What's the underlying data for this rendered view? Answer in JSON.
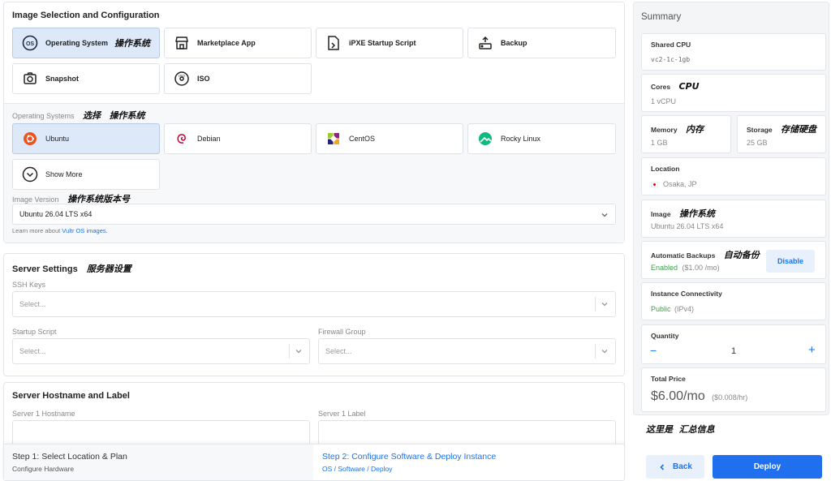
{
  "image_section": {
    "title": "Image Selection and Configuration",
    "tabs": [
      {
        "label": "Operating System",
        "annotation": "操作系统",
        "icon": "os-icon",
        "selected": true
      },
      {
        "label": "Marketplace App",
        "icon": "store-icon"
      },
      {
        "label": "iPXE Startup Script",
        "icon": "script-file-icon"
      },
      {
        "label": "Backup",
        "icon": "backup-icon"
      },
      {
        "label": "Snapshot",
        "icon": "snapshot-icon"
      },
      {
        "label": "ISO",
        "icon": "iso-disc-icon"
      }
    ]
  },
  "os_section": {
    "label": "Operating Systems",
    "annotation_1": "选择",
    "annotation_2": "操作系统",
    "options": [
      {
        "label": "Ubuntu",
        "icon": "ubuntu-icon",
        "selected": true
      },
      {
        "label": "Debian",
        "icon": "debian-icon"
      },
      {
        "label": "CentOS",
        "icon": "centos-icon"
      },
      {
        "label": "Rocky Linux",
        "icon": "rocky-linux-icon"
      },
      {
        "label": "Show More",
        "icon": "chevron-down-circle-icon"
      }
    ],
    "version_label": "Image Version",
    "version_annotation": "操作系统版本号",
    "version_value": "Ubuntu 26.04 LTS x64",
    "learn_prefix": "Learn more about ",
    "learn_link": "Vultr OS images."
  },
  "server_settings": {
    "title": "Server Settings",
    "annotation": "服务器设置",
    "ssh_label": "SSH Keys",
    "ssh_placeholder": "Select...",
    "startup_label": "Startup Script",
    "startup_placeholder": "Select...",
    "firewall_label": "Firewall Group",
    "firewall_placeholder": "Select..."
  },
  "hostname_section": {
    "title": "Server Hostname and Label",
    "hostname_label": "Server 1 Hostname",
    "label_label": "Server 1 Label"
  },
  "steps": {
    "step1_title": "Step 1: Select Location & Plan",
    "step1_sub": "Configure Hardware",
    "step2_title": "Step 2: Configure Software & Deploy Instance",
    "step2_sub": "OS / Software / Deploy"
  },
  "summary": {
    "title": "Summary",
    "shared_cpu_label": "Shared CPU",
    "shared_cpu_value": "vc2-1c-1gb",
    "cores_label": "Cores",
    "cores_annotation": "CPU",
    "cores_value": "1 vCPU",
    "memory_label": "Memory",
    "memory_annotation": "内存",
    "memory_value": "1 GB",
    "storage_label": "Storage",
    "storage_annotation": "存储硬盘",
    "storage_value": "25 GB",
    "location_label": "Location",
    "location_value": "Osaka, JP",
    "image_label": "Image",
    "image_annotation": "操作系统",
    "image_value": "Ubuntu 26.04 LTS x64",
    "backups_label": "Automatic Backups",
    "backups_annotation": "自动备份",
    "backups_status": "Enabled",
    "backups_price": "($1.00 /mo)",
    "backups_button": "Disable",
    "connectivity_label": "Instance Connectivity",
    "connectivity_status": "Public",
    "connectivity_type": "(IPv4)",
    "quantity_label": "Quantity",
    "quantity_value": "1",
    "quantity_minus": "−",
    "quantity_plus": "+",
    "total_label": "Total Price",
    "total_value": "$6.00/mo",
    "total_hourly": "($0.008/hr)",
    "footer_annotation": "这里是  汇总信息"
  },
  "actions": {
    "back": "Back",
    "deploy": "Deploy"
  },
  "colors": {
    "accent": "#1a73e8",
    "deploy_bg": "#1f6fee",
    "selected_bg": "#dde9f8",
    "success": "#3f9d4b"
  }
}
